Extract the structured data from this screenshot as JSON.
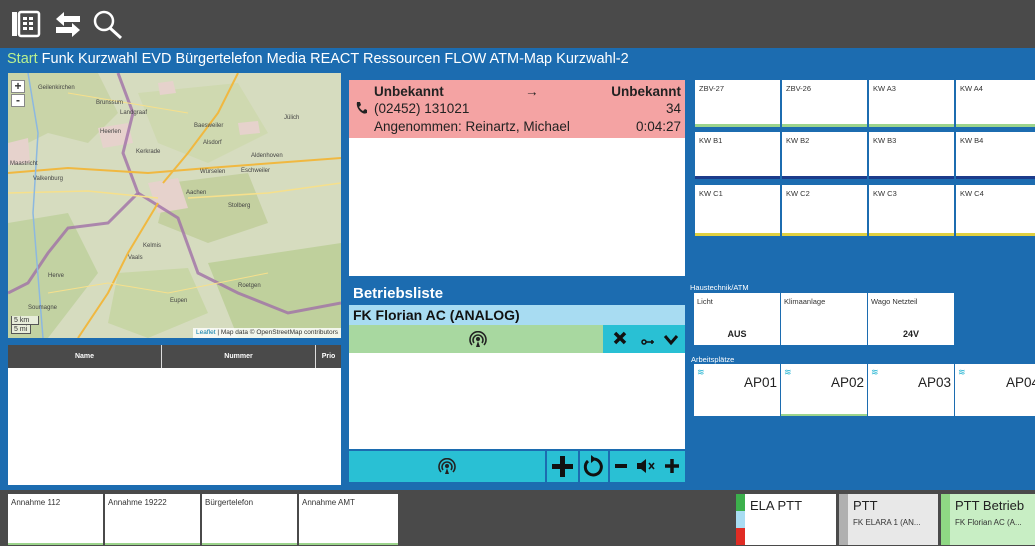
{
  "toolbar": {
    "icons": [
      "phonebook-icon",
      "transfer-arrows-icon",
      "search-icon"
    ]
  },
  "tabs": [
    "Start",
    "Funk",
    "Kurzwahl",
    "EVD",
    "Bürgertelefon",
    "Media",
    "REACT",
    "Ressourcen",
    "FLOW",
    "ATM-Map",
    "Kurzwahl-2"
  ],
  "active_tab": "Start",
  "map": {
    "zoom_in": "+",
    "zoom_out": "-",
    "scale_km": "5 km",
    "scale_mi": "5 mi",
    "attrib_link": "Leaflet",
    "attrib_text": " | Map data © OpenStreetMap contributors",
    "places": [
      "Geilenkirchen",
      "Brunssum",
      "Heerlen",
      "Landgraaf",
      "Kerkrade",
      "Baesweiler",
      "Alsdorf",
      "Aldenhoven",
      "Würselen",
      "Eschweiler",
      "Aachen",
      "Stolberg",
      "Maastricht",
      "Valkenburg",
      "Kelmis",
      "Vaals",
      "Roetgen",
      "Eupen",
      "Herve",
      "Soumagne",
      "Jülich"
    ]
  },
  "contacts": {
    "col_name": "Name",
    "col_nummer": "Nummer",
    "col_prio": "Prio"
  },
  "call": {
    "caller": "Unbekannt",
    "arrow": "→",
    "callee": "Unbekannt",
    "number": "(02452) 131021",
    "ext": "34",
    "accepted": "Angenommen: Reinartz, Michael",
    "duration": "0:04:27"
  },
  "betriebsliste": {
    "title": "Betriebsliste",
    "channel": "FK Florian AC (ANALOG)"
  },
  "kurzwahl": [
    {
      "label": "ZBV-27",
      "bar": "#9cd48c"
    },
    {
      "label": "ZBV-26",
      "bar": "#9cd48c"
    },
    {
      "label": "KW A3",
      "bar": "#9cd48c"
    },
    {
      "label": "KW A4",
      "bar": "#9cd48c"
    },
    {
      "label": "KW B1",
      "bar": "#1c3c8c"
    },
    {
      "label": "KW B2",
      "bar": "#1c3c8c"
    },
    {
      "label": "KW B3",
      "bar": "#1c3c8c"
    },
    {
      "label": "KW B4",
      "bar": "#1c3c8c"
    },
    {
      "label": "KW C1",
      "bar": "#e0d040"
    },
    {
      "label": "KW C2",
      "bar": "#e0d040"
    },
    {
      "label": "KW C3",
      "bar": "#e0d040"
    },
    {
      "label": "KW C4",
      "bar": "#e0d040"
    }
  ],
  "haustechnik": {
    "title": "Haustechnik/ATM",
    "items": [
      {
        "label": "Licht",
        "value": "AUS"
      },
      {
        "label": "Klimaanlage",
        "value": ""
      },
      {
        "label": "Wago Netzteil",
        "value": "24V"
      }
    ]
  },
  "arbeitsplaetze": {
    "title": "Arbeitsplätze",
    "items": [
      "AP01",
      "AP02",
      "AP03",
      "AP04"
    ]
  },
  "bottom_buttons": [
    "Annahme 112",
    "Annahme 19222",
    "Bürgertelefon",
    "Annahme AMT"
  ],
  "ptt": [
    {
      "title": "ELA PTT",
      "sub": ""
    },
    {
      "title": "PTT",
      "sub": "FK ELARA 1 (AN..."
    },
    {
      "title": "PTT Betrieb",
      "sub": "FK Florian AC (A..."
    }
  ],
  "colors": {
    "accent": "#1c6cb0",
    "call_bg": "#f4a3a3",
    "green": "#a8d8a0",
    "cyan": "#29c0d4",
    "light_blue": "#a8dcf2"
  }
}
